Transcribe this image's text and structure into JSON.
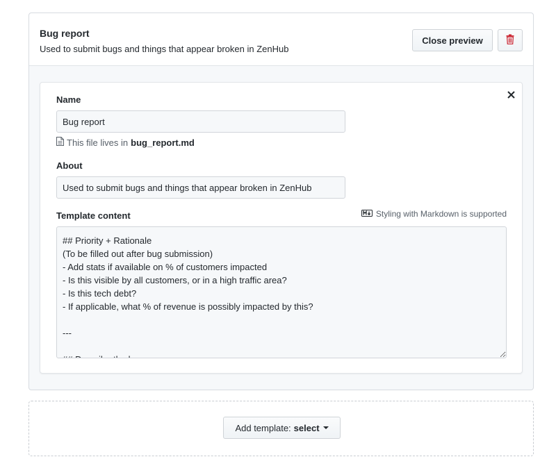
{
  "template": {
    "title": "Bug report",
    "description": "Used to submit bugs and things that appear broken in ZenHub",
    "close_preview_label": "Close preview"
  },
  "form": {
    "name_label": "Name",
    "name_value": "Bug report",
    "file_prefix": "This file lives in",
    "file_name": "bug_report.md",
    "about_label": "About",
    "about_value": "Used to submit bugs and things that appear broken in ZenHub",
    "content_label": "Template content",
    "markdown_note": "Styling with Markdown is supported",
    "content_value": "## Priority + Rationale\n(To be filled out after bug submission)\n- Add stats if available on % of customers impacted\n- Is this visible by all customers, or in a high traffic area?\n- Is this tech debt?\n- If applicable, what % of revenue is possibly impacted by this?\n\n---\n\n## Describe the bug"
  },
  "add_template": {
    "label": "Add template:",
    "selected": "select"
  },
  "colors": {
    "delete_icon": "#cb2431",
    "accent_text": "#24292e",
    "muted_text": "#586069"
  },
  "icons": {
    "delete": "trash-icon",
    "close": "close-icon",
    "file": "file-icon",
    "markdown": "markdown-icon",
    "dropdown": "caret-down-icon"
  }
}
